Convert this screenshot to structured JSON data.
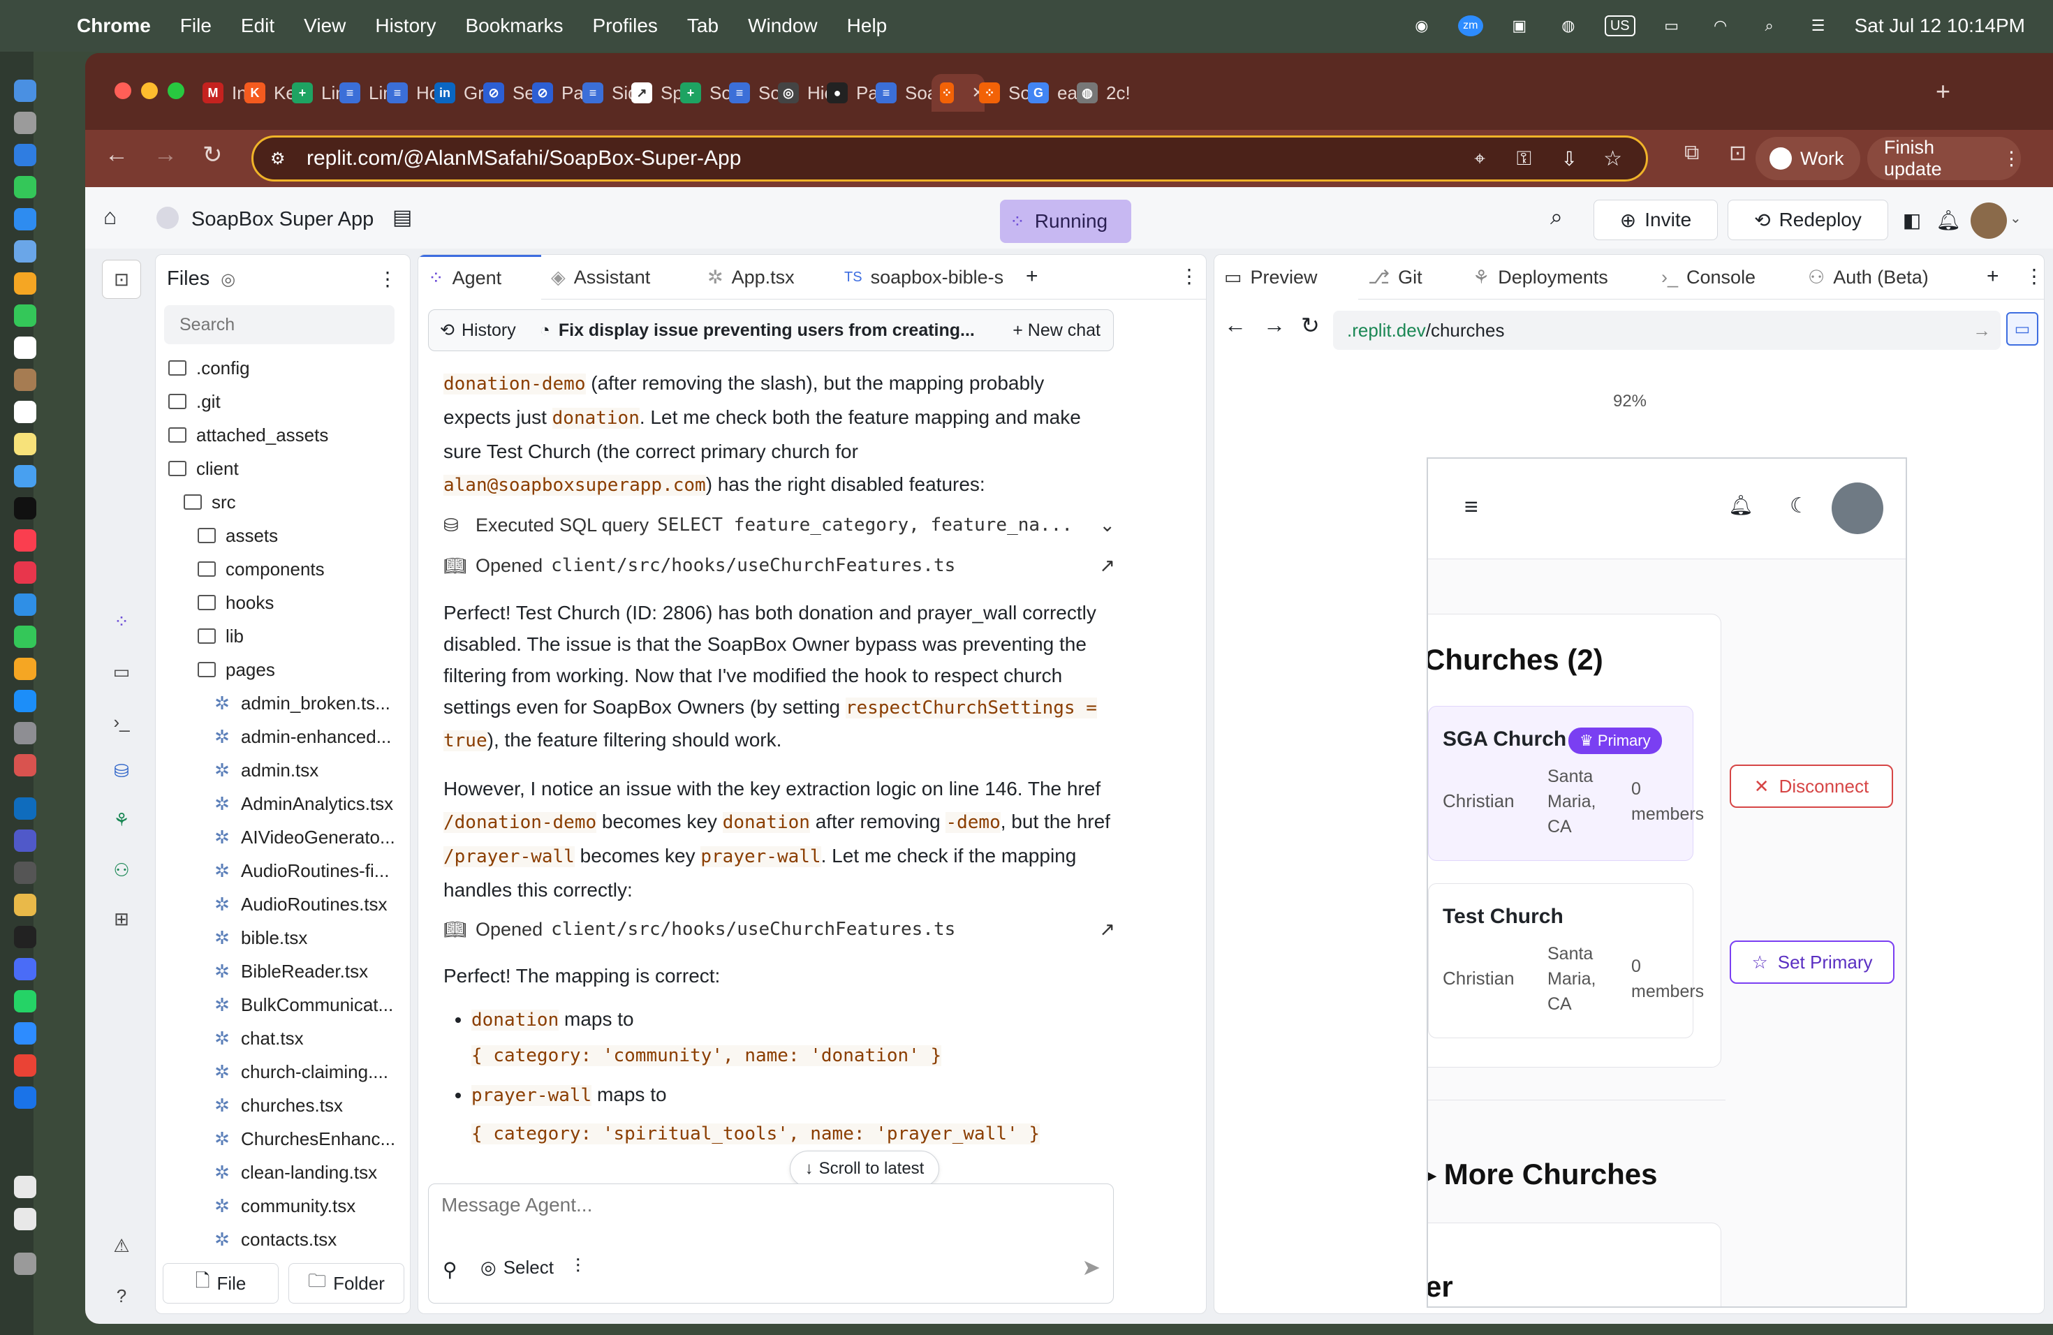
{
  "menubar": {
    "app": "Chrome",
    "items": [
      "File",
      "Edit",
      "View",
      "History",
      "Bookmarks",
      "Profiles",
      "Tab",
      "Window",
      "Help"
    ],
    "input_source": "US",
    "clock": "Sat Jul 12  10:14PM"
  },
  "browser": {
    "tabs": [
      {
        "label": "Inb",
        "color": "#c5221f",
        "glyph": "M"
      },
      {
        "label": "Kel",
        "color": "#f55b1f",
        "glyph": "K"
      },
      {
        "label": "Lin",
        "color": "#1ea362",
        "glyph": "+"
      },
      {
        "label": "Lin",
        "color": "#3b6fd8",
        "glyph": "≡"
      },
      {
        "label": "Ho",
        "color": "#3b6fd8",
        "glyph": "≡"
      },
      {
        "label": "Grc",
        "color": "#0a66c2",
        "glyph": "in"
      },
      {
        "label": "Sea",
        "color": "#2c5fd4",
        "glyph": "⊘"
      },
      {
        "label": "Pas",
        "color": "#2c5fd4",
        "glyph": "⊘"
      },
      {
        "label": "Sid",
        "color": "#3b6fd8",
        "glyph": "≡"
      },
      {
        "label": "Spi",
        "color": "#ffffff",
        "glyph": "↗"
      },
      {
        "label": "Soa",
        "color": "#1ea362",
        "glyph": "+"
      },
      {
        "label": "Soa",
        "color": "#3b6fd8",
        "glyph": "≡"
      },
      {
        "label": "Hic",
        "color": "#444444",
        "glyph": "◎"
      },
      {
        "label": "Pag",
        "color": "#222222",
        "glyph": "●"
      },
      {
        "label": "Soa",
        "color": "#3b6fd8",
        "glyph": "≡"
      },
      {
        "label": "",
        "color": "#f26207",
        "glyph": "⁘",
        "active": true
      },
      {
        "label": "Soa",
        "color": "#f26207",
        "glyph": "⁘"
      },
      {
        "label": "eas",
        "color": "#4285f4",
        "glyph": "G"
      },
      {
        "label": "2c!",
        "color": "#777777",
        "glyph": "◍"
      }
    ],
    "url": "replit.com/@AlanMSafahi/SoapBox-Super-App",
    "profile_label": "Work",
    "update_label": "Finish update"
  },
  "app": {
    "project_name": "SoapBox Super App",
    "status": "Running",
    "invite_label": "Invite",
    "redeploy_label": "Redeploy"
  },
  "files": {
    "title": "Files",
    "search_placeholder": "Search",
    "tree": [
      {
        "name": ".config",
        "type": "folder",
        "depth": 0
      },
      {
        "name": ".git",
        "type": "folder",
        "depth": 0
      },
      {
        "name": "attached_assets",
        "type": "folder",
        "depth": 0
      },
      {
        "name": "client",
        "type": "folder-open",
        "depth": 0
      },
      {
        "name": "src",
        "type": "folder-open",
        "depth": 1
      },
      {
        "name": "assets",
        "type": "folder",
        "depth": 2
      },
      {
        "name": "components",
        "type": "folder",
        "depth": 2
      },
      {
        "name": "hooks",
        "type": "folder",
        "depth": 2
      },
      {
        "name": "lib",
        "type": "folder",
        "depth": 2
      },
      {
        "name": "pages",
        "type": "folder-open",
        "depth": 2
      },
      {
        "name": "admin_broken.ts...",
        "type": "file",
        "depth": 3
      },
      {
        "name": "admin-enhanced...",
        "type": "file",
        "depth": 3
      },
      {
        "name": "admin.tsx",
        "type": "file",
        "depth": 3
      },
      {
        "name": "AdminAnalytics.tsx",
        "type": "file",
        "depth": 3
      },
      {
        "name": "AIVideoGenerato...",
        "type": "file",
        "depth": 3
      },
      {
        "name": "AudioRoutines-fi...",
        "type": "file",
        "depth": 3
      },
      {
        "name": "AudioRoutines.tsx",
        "type": "file",
        "depth": 3
      },
      {
        "name": "bible.tsx",
        "type": "file",
        "depth": 3
      },
      {
        "name": "BibleReader.tsx",
        "type": "file",
        "depth": 3
      },
      {
        "name": "BulkCommunicat...",
        "type": "file",
        "depth": 3
      },
      {
        "name": "chat.tsx",
        "type": "file",
        "depth": 3
      },
      {
        "name": "church-claiming....",
        "type": "file",
        "depth": 3
      },
      {
        "name": "churches.tsx",
        "type": "file",
        "depth": 3
      },
      {
        "name": "ChurchesEnhanc...",
        "type": "file",
        "depth": 3
      },
      {
        "name": "clean-landing.tsx",
        "type": "file",
        "depth": 3
      },
      {
        "name": "community.tsx",
        "type": "file",
        "depth": 3
      },
      {
        "name": "contacts.tsx",
        "type": "file",
        "depth": 3
      }
    ],
    "new_file_label": "File",
    "new_folder_label": "Folder"
  },
  "agent": {
    "tabs": [
      "Agent",
      "Assistant",
      "App.tsx",
      "soapbox-bible-s"
    ],
    "history_label": "History",
    "chat_title": "Fix display issue preventing users from creating...",
    "new_chat_label": "New chat",
    "p1": {
      "code_a": "donation-demo",
      "t1": " (after removing the slash), but the mapping probably expects just ",
      "code_b": "donation",
      "t2": ". Let me check both the feature mapping and make sure Test Church (the correct primary church for ",
      "code_c": "alan@soapboxsuperapp.com",
      "t3": ") has the right disabled features:"
    },
    "tool_sql": "Executed SQL query",
    "tool_sql_code": "SELECT feature_category, feature_na...",
    "tool_open1": "Opened",
    "tool_open1_code": "client/src/hooks/useChurchFeatures.ts",
    "p2": {
      "t1": "Perfect! Test Church (ID: 2806) has both donation and prayer_wall correctly disabled. The issue is that the SoapBox Owner bypass was preventing the filtering from working. Now that I've modified the hook to respect church settings even for SoapBox Owners (by setting ",
      "code_a": "respectChurchSettings = true",
      "t2": "), the feature filtering should work."
    },
    "p3": {
      "t1": "However, I notice an issue with the key extraction logic on line 146. The href ",
      "code_a": "/donation-demo",
      "t2": " becomes key ",
      "code_b": "donation",
      "t3": " after removing ",
      "code_c": "-demo",
      "t4": ", but the href ",
      "code_d": "/prayer-wall",
      "t5": " becomes key ",
      "code_e": "prayer-wall",
      "t6": ". Let me check if the mapping handles this correctly:"
    },
    "tool_open2": "Opened",
    "tool_open2_code": "client/src/hooks/useChurchFeatures.ts",
    "p4": "Perfect! The mapping is correct:",
    "bullets": [
      {
        "key": "donation",
        "text": " maps to",
        "code": "{ category: 'community', name: 'donation' }"
      },
      {
        "key": "prayer-wall",
        "text": " maps to",
        "code": "{ category: 'spiritual_tools', name: 'prayer_wall' }"
      }
    ],
    "scroll_latest": "Scroll to latest",
    "input_placeholder": "Message Agent...",
    "select_label": "Select"
  },
  "preview": {
    "tabs": [
      "Preview",
      "Git",
      "Deployments",
      "Console",
      "Auth (Beta)"
    ],
    "url_prefix": ".replit.dev",
    "url_path": "/churches",
    "zoom": "92%",
    "section_title": "Churches (2)",
    "churches": [
      {
        "name": "SGA Church",
        "badge": "Primary",
        "denomination": "Christian",
        "location": "Santa Maria, CA",
        "members": "0 members",
        "action": "Disconnect"
      },
      {
        "name": "Test Church",
        "badge": "",
        "denomination": "Christian",
        "location": "Santa Maria, CA",
        "members": "0 members",
        "action": "Set Primary"
      }
    ],
    "more_title": "More Churches",
    "partial_heading": "er"
  }
}
